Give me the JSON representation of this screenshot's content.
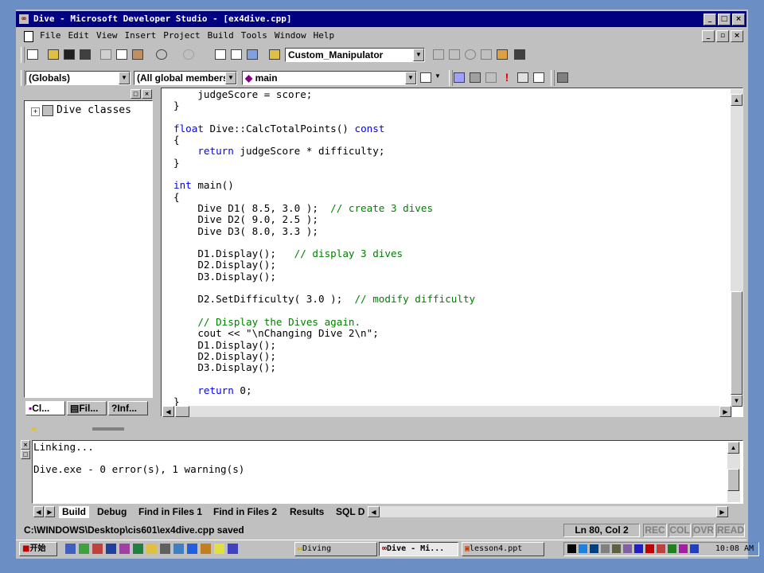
{
  "window": {
    "title": "Dive - Microsoft Developer Studio - [ex4dive.cpp]",
    "app_icon": "dev-studio-icon"
  },
  "menu": [
    "File",
    "Edit",
    "View",
    "Insert",
    "Project",
    "Build",
    "Tools",
    "Window",
    "Help"
  ],
  "toolbar1": {
    "find_combo": "Custom_Manipulator"
  },
  "toolbar2": {
    "scope_combo": "(Globals)",
    "members_combo": "(All global members",
    "function_combo": "main"
  },
  "workspace": {
    "tree_root": "Dive classes",
    "tabs": [
      "Cl...",
      "Fil...",
      "Inf..."
    ]
  },
  "code_lines": [
    {
      "t": "    judgeScore = score;"
    },
    {
      "t": "}"
    },
    {
      "t": ""
    },
    {
      "t": "float",
      "kw": true,
      "r": " Dive::CalcTotalPoints() "
    },
    {
      "t": "{"
    },
    {
      "t": "    "
    },
    {
      "t": "}"
    },
    {
      "t": ""
    },
    {
      "t": "int",
      "kw": true,
      "r": " main()"
    },
    {
      "t": "{"
    },
    {
      "t": "    Dive D1( 8.5, 3.0 );  ",
      "c": "// create 3 dives"
    },
    {
      "t": "    Dive D2( 9.0, 2.5 );"
    },
    {
      "t": "    Dive D3( 8.0, 3.3 );"
    },
    {
      "t": ""
    },
    {
      "t": "    D1.Display();   ",
      "c": "// display 3 dives"
    },
    {
      "t": "    D2.Display();"
    },
    {
      "t": "    D3.Display();"
    },
    {
      "t": ""
    },
    {
      "t": "    D2.SetDifficulty( 3.0 );  ",
      "c": "// modify difficulty"
    },
    {
      "t": ""
    },
    {
      "t": "    ",
      "c": "// Display the Dives again."
    },
    {
      "t": "    cout << \"\\nChanging Dive 2\\n\";"
    },
    {
      "t": "    D1.Display();"
    },
    {
      "t": "    D2.Display();"
    },
    {
      "t": "    D3.Display();"
    },
    {
      "t": ""
    },
    {
      "t": "    "
    },
    {
      "t": "}"
    }
  ],
  "code_extra": {
    "const_kw": "const",
    "return_kw": "return",
    "return_expr": " judgeScore * difficulty;",
    "return0": " 0;"
  },
  "output": {
    "lines": [
      "Linking...",
      "",
      "Dive.exe - 0 error(s), 1 warning(s)"
    ],
    "tabs": [
      "Build",
      "Debug",
      "Find in Files 1",
      "Find in Files 2",
      "Results",
      "SQL D"
    ]
  },
  "statusbar": {
    "message": "C:\\WINDOWS\\Desktop\\cis601\\ex4dive.cpp saved",
    "position": "Ln 80, Col 2",
    "indicators": [
      "REC",
      "COL",
      "OVR",
      "READ"
    ]
  },
  "taskbar": {
    "start": "开始",
    "tasks": [
      "Diving",
      "Dive - Mi...",
      "lesson4.ppt"
    ],
    "clock": "10:08 AM"
  }
}
